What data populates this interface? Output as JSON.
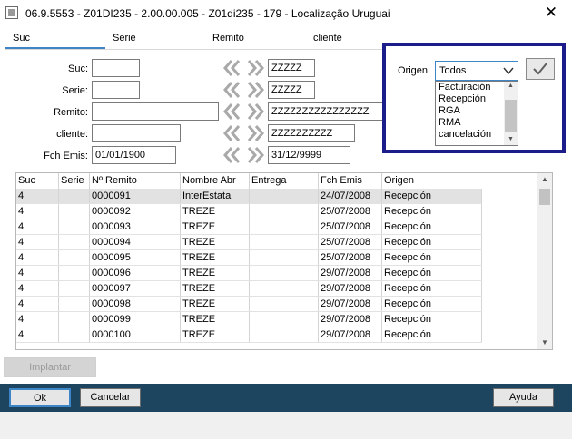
{
  "window": {
    "title": "06.9.5553 - Z01DI235 - 2.00.00.005 - Z01di235 - 179 - Localização Uruguai",
    "close_glyph": "✕"
  },
  "tabs": [
    {
      "label": "Suc"
    },
    {
      "label": "Serie"
    },
    {
      "label": "Remito"
    },
    {
      "label": "cliente"
    }
  ],
  "filters": {
    "suc": {
      "label": "Suc:",
      "from": "",
      "to": "ZZZZZ"
    },
    "serie": {
      "label": "Serie:",
      "from": "",
      "to": "ZZZZZ"
    },
    "remito": {
      "label": "Remito:",
      "from": "",
      "to": "ZZZZZZZZZZZZZZZZ"
    },
    "cliente": {
      "label": "cliente:",
      "from": "",
      "to": "ZZZZZZZZZZ"
    },
    "fch_emis": {
      "label": "Fch Emis:",
      "from": "01/01/1900",
      "to": "31/12/9999"
    }
  },
  "origen": {
    "label": "Origen:",
    "selected": "Todos",
    "options": [
      "Facturación",
      "Recepción",
      "RGA",
      "RMA",
      "cancelación"
    ]
  },
  "grid": {
    "columns": [
      "Suc",
      "Serie",
      "Nº Remito",
      "Nombre Abr",
      "Entrega",
      "Fch Emis",
      "Origen"
    ],
    "rows": [
      [
        "4",
        "",
        "0000091",
        "InterEstatal",
        "",
        "24/07/2008",
        "Recepción"
      ],
      [
        "4",
        "",
        "0000092",
        "TREZE",
        "",
        "25/07/2008",
        "Recepción"
      ],
      [
        "4",
        "",
        "0000093",
        "TREZE",
        "",
        "25/07/2008",
        "Recepción"
      ],
      [
        "4",
        "",
        "0000094",
        "TREZE",
        "",
        "25/07/2008",
        "Recepción"
      ],
      [
        "4",
        "",
        "0000095",
        "TREZE",
        "",
        "25/07/2008",
        "Recepción"
      ],
      [
        "4",
        "",
        "0000096",
        "TREZE",
        "",
        "29/07/2008",
        "Recepción"
      ],
      [
        "4",
        "",
        "0000097",
        "TREZE",
        "",
        "29/07/2008",
        "Recepción"
      ],
      [
        "4",
        "",
        "0000098",
        "TREZE",
        "",
        "29/07/2008",
        "Recepción"
      ],
      [
        "4",
        "",
        "0000099",
        "TREZE",
        "",
        "29/07/2008",
        "Recepción"
      ],
      [
        "4",
        "",
        "0000100",
        "TREZE",
        "",
        "29/07/2008",
        "Recepción"
      ]
    ]
  },
  "buttons": {
    "implantar": "Implantar",
    "ok": "Ok",
    "cancelar": "Cancelar",
    "ayuda": "Ayuda"
  },
  "colors": {
    "accent": "#3d85c6",
    "highlight_border": "#1c1c8a",
    "bottom_bar": "#1e4560",
    "arrow": "#a9a9a9",
    "check": "#606060"
  },
  "icons": {
    "range_arrow": "double-chevron-icon",
    "confirm": "checkmark-icon",
    "dropdown": "chevron-down-icon"
  }
}
